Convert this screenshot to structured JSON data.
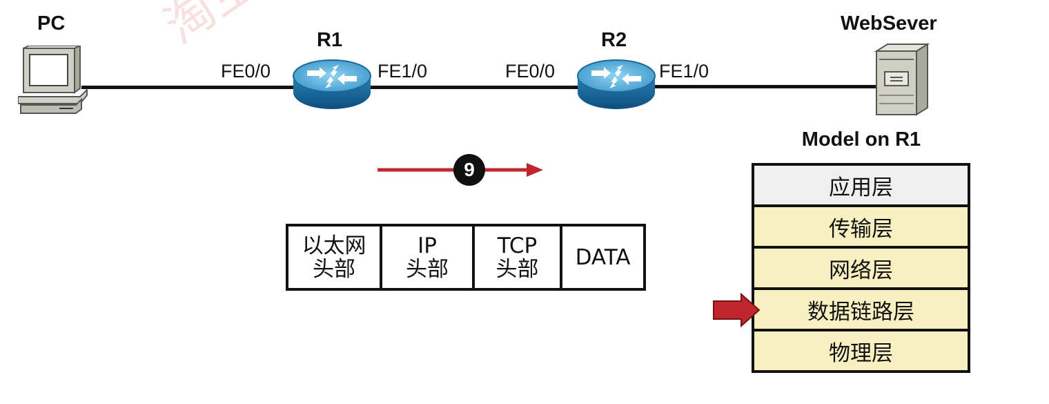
{
  "watermark": "淘宝专",
  "nodes": {
    "pc": "PC",
    "r1": "R1",
    "r2": "R2",
    "server": "WebSever"
  },
  "ports": {
    "r1_left": "FE0/0",
    "r1_right": "FE1/0",
    "r2_left": "FE0/0",
    "r2_right": "FE1/0"
  },
  "step": {
    "number": "9",
    "arrow_color": "#c0262c"
  },
  "frame": [
    {
      "line1": "以太网",
      "line2": "头部"
    },
    {
      "line1": "IP",
      "line2": "头部"
    },
    {
      "line1": "TCP",
      "line2": "头部"
    },
    {
      "line1": "DATA",
      "line2": ""
    }
  ],
  "model": {
    "title": "Model on R1",
    "layers": [
      "应用层",
      "传输层",
      "网络层",
      "数据链路层",
      "物理层"
    ],
    "current_layer": "数据链路层",
    "pointer_color": "#c0262c",
    "layer_color": "#f8f0c0"
  }
}
